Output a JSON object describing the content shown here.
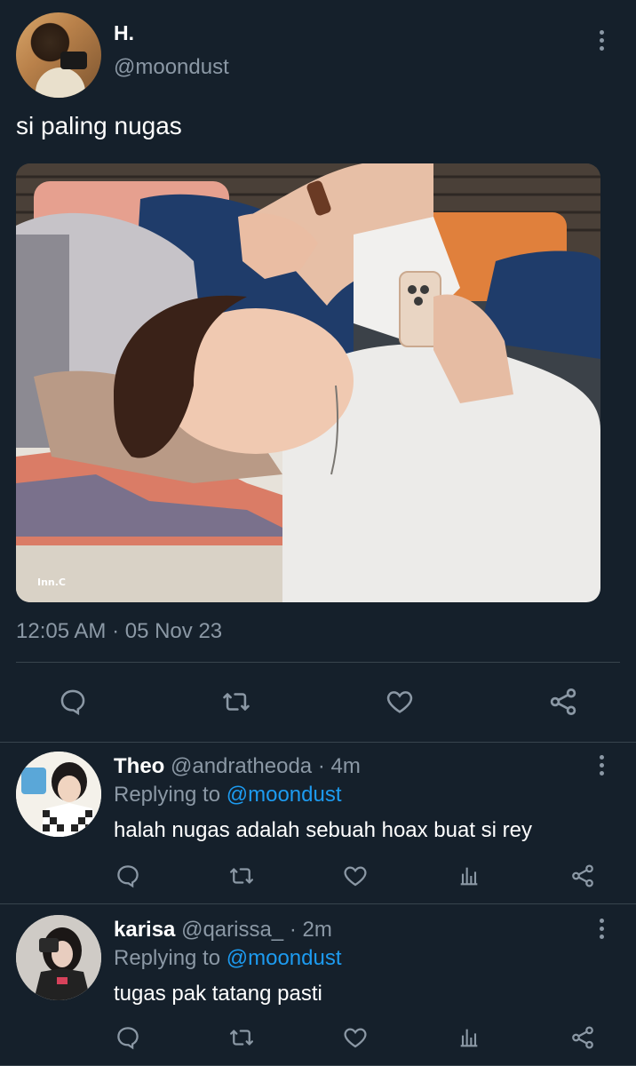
{
  "tweet": {
    "display_name": "H.",
    "handle": "@moondust",
    "text": "si paling nugas",
    "timestamp": "12:05 AM · 05 Nov 23",
    "media_watermark": "Inn.C",
    "avatar_icon": "profile-photo-camera"
  },
  "actions": {
    "reply_icon": "speech-bubble-icon",
    "retweet_icon": "retweet-icon",
    "like_icon": "heart-icon",
    "share_icon": "share-icon",
    "analytics_icon": "bar-chart-icon"
  },
  "replies": [
    {
      "name": "Theo",
      "handle": "@andratheoda",
      "time": "· 4m",
      "replying_prefix": "Replying to",
      "replying_to": "@moondust",
      "text": "halah nugas adalah sebuah hoax buat si rey"
    },
    {
      "name": "karisa",
      "handle": "@qarissa_",
      "time": "· 2m",
      "replying_prefix": "Replying to",
      "replying_to": "@moondust",
      "text": "tugas pak tatang pasti"
    }
  ],
  "colors": {
    "background": "#15202b",
    "text": "#ffffff",
    "muted": "#8b98a5",
    "link": "#1d9bf0",
    "divider": "#38444d"
  }
}
